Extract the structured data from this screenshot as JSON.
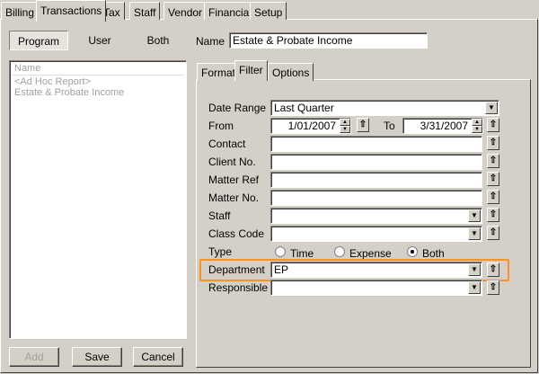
{
  "top_tabs": [
    "Billing",
    "Transactions",
    "Tax",
    "Staff",
    "Vendor",
    "Financial",
    "Setup"
  ],
  "top_tabs_underline": [
    "B",
    "T",
    "x",
    "S",
    "V",
    "F",
    "S"
  ],
  "mode_buttons": {
    "program": "Program",
    "user": "User",
    "both": "Both"
  },
  "name_label": "Name",
  "name_value": "Estate & Probate Income",
  "list": {
    "header": "Name",
    "items": [
      "<Ad Hoc Report>",
      "Estate & Probate Income"
    ]
  },
  "buttons": {
    "add": "Add",
    "save": "Save",
    "cancel": "Cancel"
  },
  "inner_tabs": [
    "Format",
    "Filter",
    "Options"
  ],
  "filter": {
    "date_range_label": "Date Range",
    "date_range_value": "Last Quarter",
    "from_label": "From",
    "from_value": "1/01/2007",
    "to_label": "To",
    "to_value": "3/31/2007",
    "contact_label": "Contact",
    "client_no_label": "Client No.",
    "matter_ref_label": "Matter Ref",
    "matter_no_label": "Matter No.",
    "staff_label": "Staff",
    "class_code_label": "Class Code",
    "type_label": "Type",
    "type_options": [
      "Time",
      "Expense",
      "Both"
    ],
    "type_selected": "Both",
    "department_label": "Department",
    "department_value": "EP",
    "responsible_label": "Responsible"
  },
  "icons": {
    "dropdown": "chevron-down-icon",
    "spin": "spin-arrows-icon",
    "lookup": "up-arrow-lookup-icon"
  },
  "colors": {
    "highlight": "#f5922a",
    "background": "#d4d0c8"
  }
}
